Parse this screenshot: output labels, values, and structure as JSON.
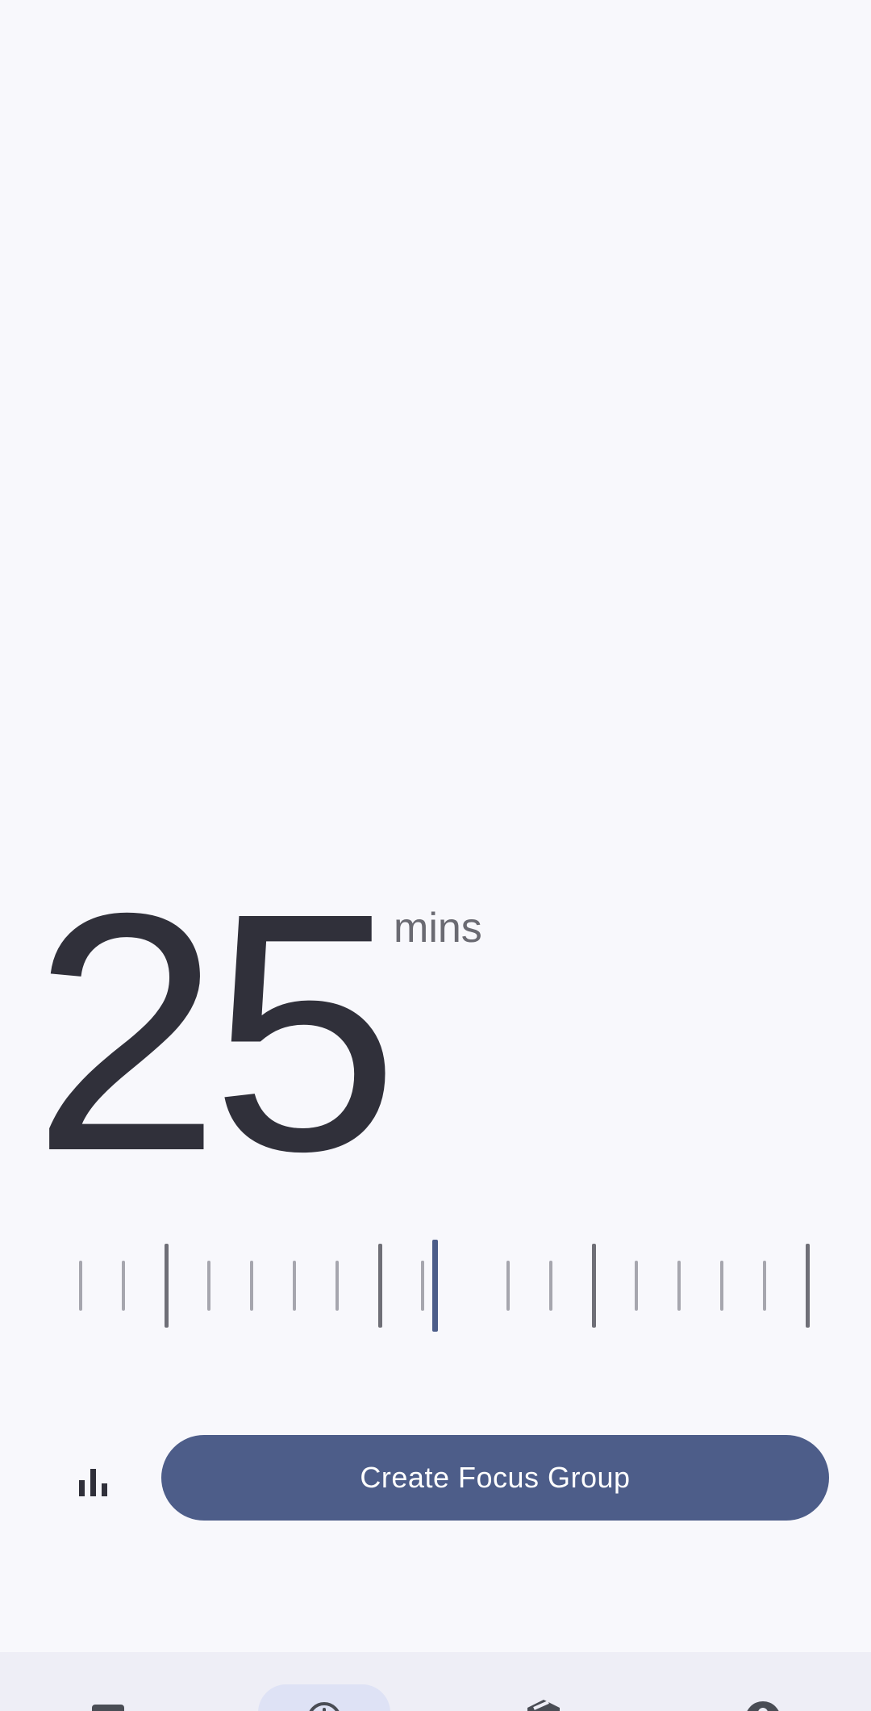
{
  "timer": {
    "value": "25",
    "unit": "mins"
  },
  "ruler": {
    "selected_index": 9,
    "tick_count": 18
  },
  "actions": {
    "stats_icon": "bar-chart-icon",
    "create_label": "Create Focus Group"
  },
  "bottom_nav": {
    "items": [
      {
        "icon": "calendar-icon"
      },
      {
        "icon": "timer-icon",
        "selected": true
      },
      {
        "icon": "package-icon"
      },
      {
        "icon": "account-icon"
      }
    ]
  },
  "colors": {
    "background": "#F8F8FC",
    "accent": "#4D5D89",
    "text": "#30303A",
    "nav_background": "#EEEEF6",
    "nav_selected_pill": "#DEE2F5"
  }
}
